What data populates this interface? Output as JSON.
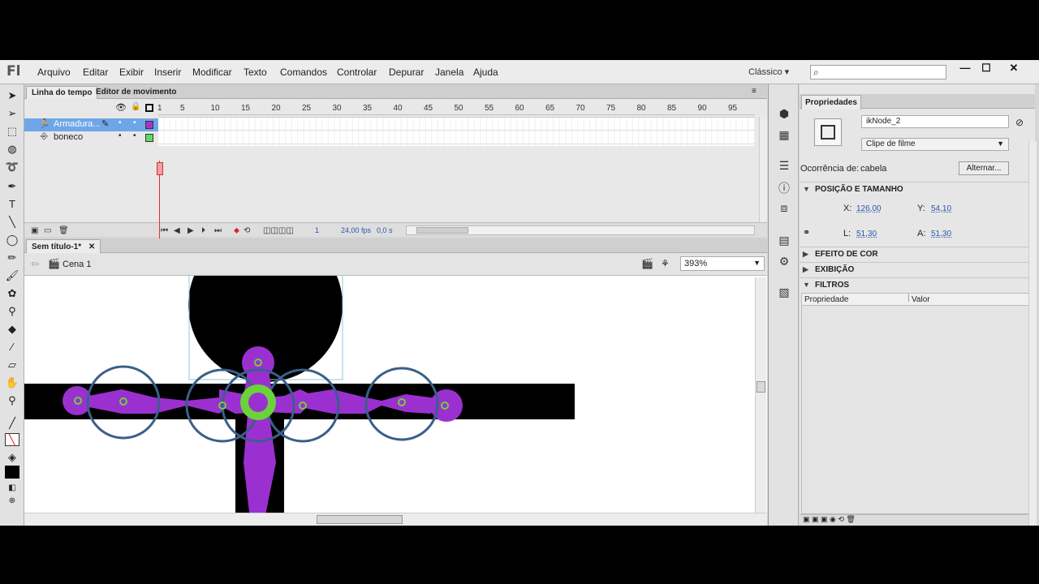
{
  "app": {
    "logo": "Fl",
    "menu": [
      "Arquivo",
      "Editar",
      "Exibir",
      "Inserir",
      "Modificar",
      "Texto",
      "Comandos",
      "Controlar",
      "Depurar",
      "Janela",
      "Ajuda"
    ],
    "workspace": "Clássico"
  },
  "timeline": {
    "tabs": [
      "Linha do tempo",
      "Editor de movimento"
    ],
    "ruler_numbers": [
      "1",
      "5",
      "10",
      "15",
      "20",
      "25",
      "30",
      "35",
      "40",
      "45",
      "50",
      "55",
      "60",
      "65",
      "70",
      "75",
      "80",
      "85",
      "90",
      "95"
    ],
    "layers": [
      {
        "name": "Armadura...",
        "color": "#a338c7",
        "selected": true
      },
      {
        "name": "boneco",
        "color": "#5fdc5f",
        "selected": false
      }
    ],
    "footer": {
      "frame": "1",
      "fps": "24,00 fps",
      "time": "0,0 s"
    }
  },
  "document": {
    "tab": "Sem título-1*",
    "scene": "Cena 1",
    "zoom": "393%"
  },
  "properties": {
    "panel_tab": "Propriedades",
    "instance_name": "ikNode_2",
    "instance_type": "Clipe de filme",
    "occurrence_label": "Ocorrência de:",
    "occurrence_value": "cabela",
    "swap_button": "Alternar...",
    "sections": {
      "position_size": "POSIÇÃO E TAMANHO",
      "color_effect": "EFEITO DE COR",
      "display": "EXIBIÇÃO",
      "filters": "FILTROS"
    },
    "x_label": "X:",
    "x_value": "126,00",
    "y_label": "Y:",
    "y_value": "54,10",
    "w_label": "L:",
    "w_value": "51,30",
    "h_label": "A:",
    "h_value": "51,30",
    "filters_cols": [
      "Propriedade",
      "Valor"
    ]
  },
  "colors": {
    "bone": "#9b30d0",
    "joint_ring": "#3a5f8a",
    "joint_center": "#6cd23a",
    "shape": "#000000"
  }
}
